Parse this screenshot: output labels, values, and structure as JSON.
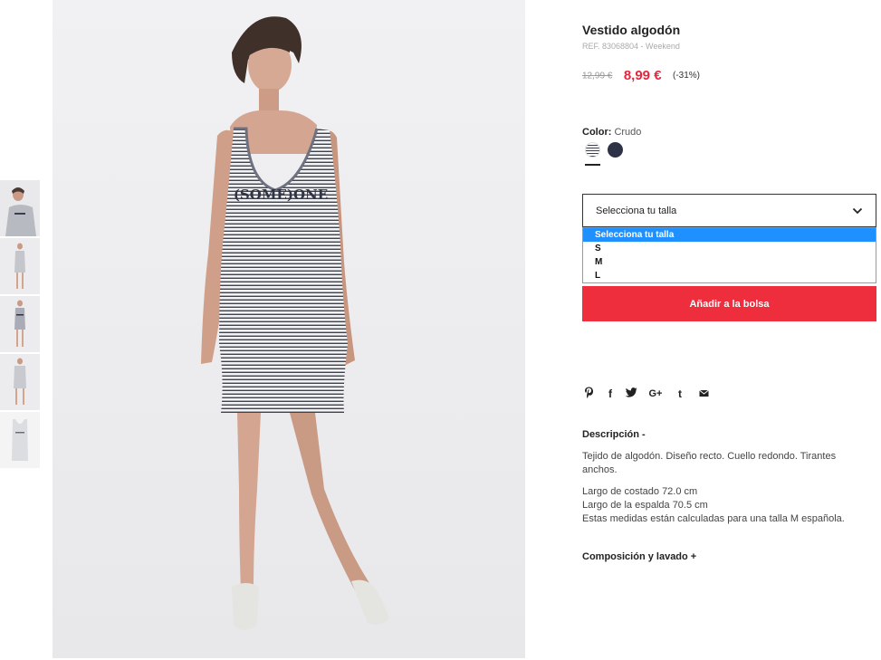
{
  "product": {
    "title": "Vestido algodón",
    "reference": "REF. 83068804 - Weekend",
    "old_price": "12,99 €",
    "new_price": "8,99 €",
    "discount": "(-31%)"
  },
  "color": {
    "label": "Color:",
    "value": "Crudo",
    "swatches": [
      {
        "name": "striped-crudo",
        "color": "#3b3e50",
        "selected": true
      },
      {
        "name": "navy",
        "color": "#2d3246",
        "selected": false
      }
    ]
  },
  "size_select": {
    "value": "Selecciona tu talla",
    "options": [
      "Selecciona tu talla",
      "S",
      "M",
      "L"
    ],
    "highlighted_option": "Selecciona tu talla"
  },
  "add_to_bag": "Añadir a la bolsa",
  "share_icons": [
    "pinterest-icon",
    "facebook-icon",
    "twitter-icon",
    "google-plus-icon",
    "tumblr-icon",
    "email-icon"
  ],
  "share_glyphs": {
    "pinterest": "℗",
    "facebook": "f",
    "twitter": "🐦",
    "googleplus": "G+",
    "tumblr": "t",
    "email": "✉"
  },
  "description": {
    "title": "Descripción -",
    "text": "Tejido de algodón. Diseño recto. Cuello redondo. Tirantes anchos.",
    "measure_1": "Largo de costado 72.0 cm",
    "measure_2": "Largo de la espalda 70.5 cm",
    "measure_3": "Estas medidas están calculadas para una talla M española."
  },
  "composition_title": "Composición y lavado +",
  "dress_print": "(SOME)ONE",
  "colors": {
    "accent_red": "#ee2d3d",
    "price_red": "#e8253a",
    "highlight_blue": "#1e90ff"
  }
}
